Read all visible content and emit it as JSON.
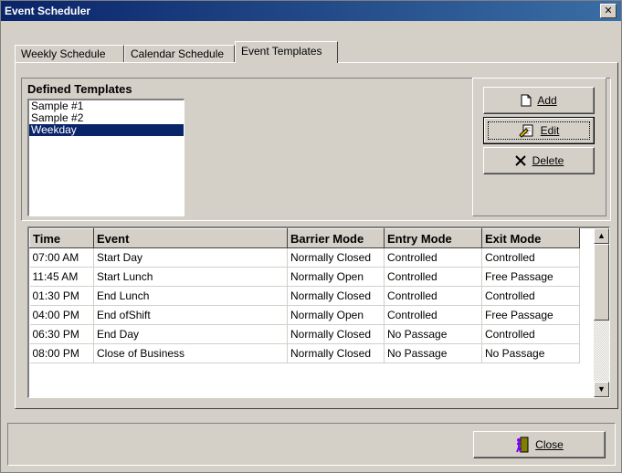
{
  "window": {
    "title": "Event Scheduler",
    "close_glyph": "✕"
  },
  "tabs": [
    {
      "label": "Weekly Schedule",
      "active": false
    },
    {
      "label": "Calendar Schedule",
      "active": false
    },
    {
      "label": "Event Templates",
      "active": true
    }
  ],
  "templates": {
    "heading": "Defined Templates",
    "items": [
      "Sample #1",
      "Sample #2",
      "Weekday"
    ],
    "selected_index": 2
  },
  "buttons": {
    "add": {
      "label": "Add",
      "icon": "new-document-icon"
    },
    "edit": {
      "label": "Edit",
      "icon": "edit-document-icon"
    },
    "delete": {
      "label": "Delete",
      "icon": "delete-x-icon"
    },
    "close": {
      "label": "Close",
      "icon": "exit-door-icon"
    }
  },
  "table": {
    "columns": [
      "Time",
      "Event",
      "Barrier Mode",
      "Entry Mode",
      "Exit Mode"
    ],
    "rows": [
      [
        "07:00 AM",
        "Start Day",
        "Normally Closed",
        "Controlled",
        "Controlled"
      ],
      [
        "11:45 AM",
        "Start Lunch",
        "Normally Open",
        "Controlled",
        "Free Passage"
      ],
      [
        "01:30 PM",
        "End Lunch",
        "Normally Closed",
        "Controlled",
        "Controlled"
      ],
      [
        "04:00 PM",
        "End ofShift",
        "Normally Open",
        "Controlled",
        "Free Passage"
      ],
      [
        "06:30 PM",
        "End Day",
        "Normally Closed",
        "No Passage",
        "Controlled"
      ],
      [
        "08:00 PM",
        "Close of Business",
        "Normally Closed",
        "No Passage",
        "No Passage"
      ]
    ]
  },
  "colors": {
    "selection": "#0a246a",
    "title_start": "#0a246a",
    "title_end": "#3a6ea5"
  }
}
